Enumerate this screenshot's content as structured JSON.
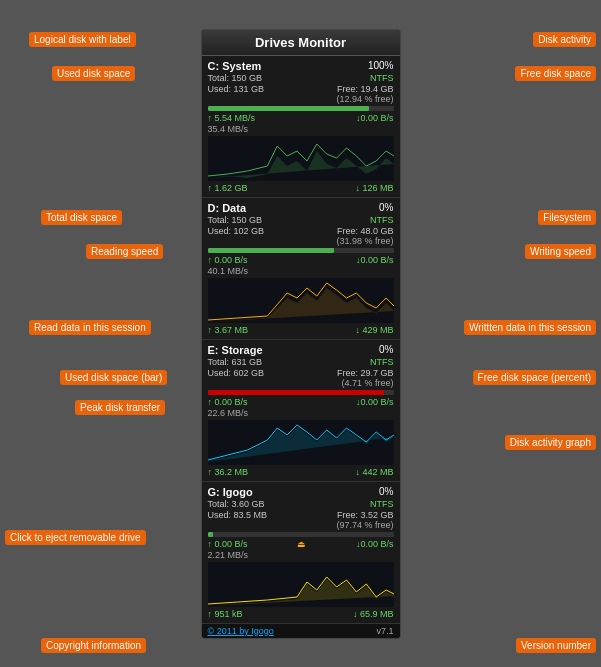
{
  "title": "Drives Monitor",
  "annotations": {
    "logical_disk": "Logical disk with label",
    "disk_activity": "Disk activity",
    "used_disk_space": "Used disk space",
    "free_disk_space": "Free disk space",
    "total_disk_space": "Total disk space",
    "filesystem": "Filesystem",
    "reading_speed": "Reading speed",
    "writing_speed": "Writing speed",
    "read_data_session": "Read data in this session",
    "written_data_session": "Writtten data in this session",
    "used_disk_space_bar": "Used disk space (bar)",
    "free_disk_space_percent": "Free disk space (percent)",
    "peak_disk_transfer": "Peak disk transfer",
    "disk_activity_graph": "Disk activity graph",
    "click_to_eject": "Click to eject removable drive",
    "copyright_info": "Copyright information",
    "version_number": "Version number"
  },
  "drives": [
    {
      "id": "C",
      "label": "C: System",
      "percent": "100%",
      "total": "Total: 150 GB",
      "used": "Used: 131 GB",
      "filesystem": "NTFS",
      "free": "Free: 19.4 GB",
      "free_percent": "(12.94 % free)",
      "read_speed": "↑ 5.54 MB/s",
      "write_speed": "↓0.00 B/s",
      "peak": "35.4 MB/s",
      "read_session": "↑ 1.62 GB",
      "write_session": "↓ 126 MB",
      "bar_fill": 87,
      "bar_color": "green",
      "ejectable": false
    },
    {
      "id": "D",
      "label": "D: Data",
      "percent": "0%",
      "total": "Total: 150 GB",
      "used": "Used: 102 GB",
      "filesystem": "NTFS",
      "free": "Free: 48.0 GB",
      "free_percent": "(31.98 % free)",
      "read_speed": "↑ 0.00 B/s",
      "write_speed": "↓0.00 B/s",
      "peak": "40.1 MB/s",
      "read_session": "↑ 3.67 MB",
      "write_session": "↓ 429 MB",
      "bar_fill": 68,
      "bar_color": "green",
      "ejectable": false
    },
    {
      "id": "E",
      "label": "E: Storage",
      "percent": "0%",
      "total": "Total: 631 GB",
      "used": "Used: 602 GB",
      "filesystem": "NTFS",
      "free": "Free: 29.7 GB",
      "free_percent": "(4.71 % free)",
      "read_speed": "↑ 0.00 B/s",
      "write_speed": "↓0.00 B/s",
      "peak": "22.6 MB/s",
      "read_session": "↑ 36.2 MB",
      "write_session": "↓ 442 MB",
      "bar_fill": 95,
      "bar_color": "red",
      "ejectable": false
    },
    {
      "id": "G",
      "label": "G: Igogo",
      "percent": "0%",
      "total": "Total: 3.60 GB",
      "used": "Used: 83.5 MB",
      "filesystem": "NTFS",
      "free": "Free: 3.52 GB",
      "free_percent": "(97.74 % free)",
      "read_speed": "↑ 0.00 B/s",
      "write_speed": "↓0.00 B/s",
      "peak": "2.21 MB/s",
      "read_session": "↑ 951 kB",
      "write_session": "↓ 65.9 MB",
      "bar_fill": 3,
      "bar_color": "green",
      "ejectable": true
    }
  ],
  "footer": {
    "copyright": "© 2011 by Igogo",
    "version": "v7.1"
  }
}
